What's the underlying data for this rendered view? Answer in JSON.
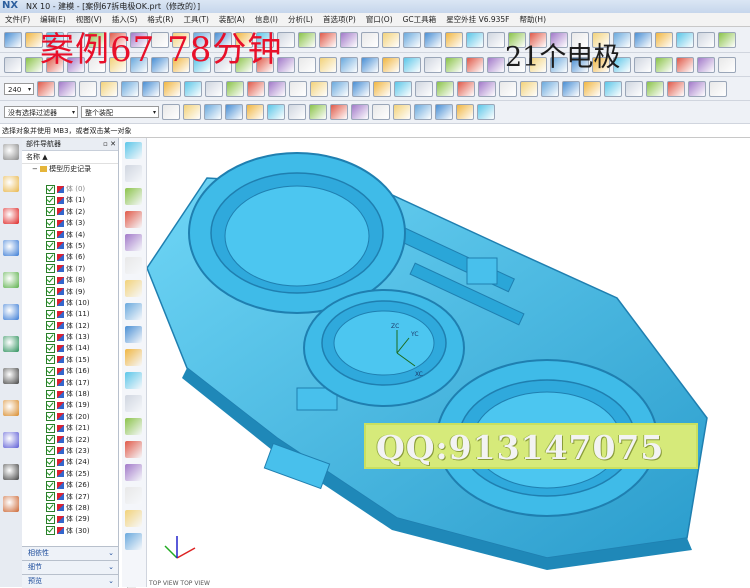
{
  "window": {
    "logo": "NX",
    "title": "NX 10 - 建模 - [案例67拆电极OK.prt（修改的）]"
  },
  "menu": [
    "文件(F)",
    "编辑(E)",
    "视图(V)",
    "插入(S)",
    "格式(R)",
    "工具(T)",
    "装配(A)",
    "信息(I)",
    "分析(L)",
    "首选项(P)",
    "窗口(O)",
    "GC工具箱",
    "星空外挂 V6.935F",
    "帮助(H)"
  ],
  "overlay": {
    "red_text": "案例67   78分钟",
    "dark_text": "21个电极",
    "qq_text": "QQ:913147075"
  },
  "filters": {
    "zoom_value": "240",
    "selection_filter": "没有选择过滤器",
    "assembly_scope": "整个装配"
  },
  "status_prompt": "选择对象并使用 MB3，或者双击某一对象",
  "navigator": {
    "title": "部件导航器",
    "column_name": "名称",
    "root": "模型历史记录",
    "items": [
      "体 (0)",
      "体 (1)",
      "体 (2)",
      "体 (3)",
      "体 (4)",
      "体 (5)",
      "体 (6)",
      "体 (7)",
      "体 (8)",
      "体 (9)",
      "体 (10)",
      "体 (11)",
      "体 (12)",
      "体 (13)",
      "体 (14)",
      "体 (15)",
      "体 (16)",
      "体 (17)",
      "体 (18)",
      "体 (19)",
      "体 (20)",
      "体 (21)",
      "体 (22)",
      "体 (23)",
      "体 (24)",
      "体 (25)",
      "体 (26)",
      "体 (27)",
      "体 (28)",
      "体 (29)",
      "体 (30)"
    ],
    "panels": [
      "相依性",
      "细节",
      "预览"
    ]
  },
  "viewport": {
    "triad_labels": {
      "x": "XC",
      "y": "YC",
      "z": "ZC"
    },
    "bottom_labels": "TOP VIEW   TOP VIEW"
  },
  "colors": {
    "model": "#34b6e6",
    "model_shadow": "#1f7fb0",
    "accent": "#2d5f9e",
    "overlay_red": "#e8102a",
    "qq_bg": "#d6ea7a"
  },
  "icons": [
    "gear-icon",
    "feature-icon",
    "assembly-icon",
    "constraint-icon",
    "palette-icon",
    "info-icon",
    "web-icon",
    "clock-icon",
    "history-icon",
    "analysis-icon",
    "tools-icon",
    "render-icon"
  ]
}
